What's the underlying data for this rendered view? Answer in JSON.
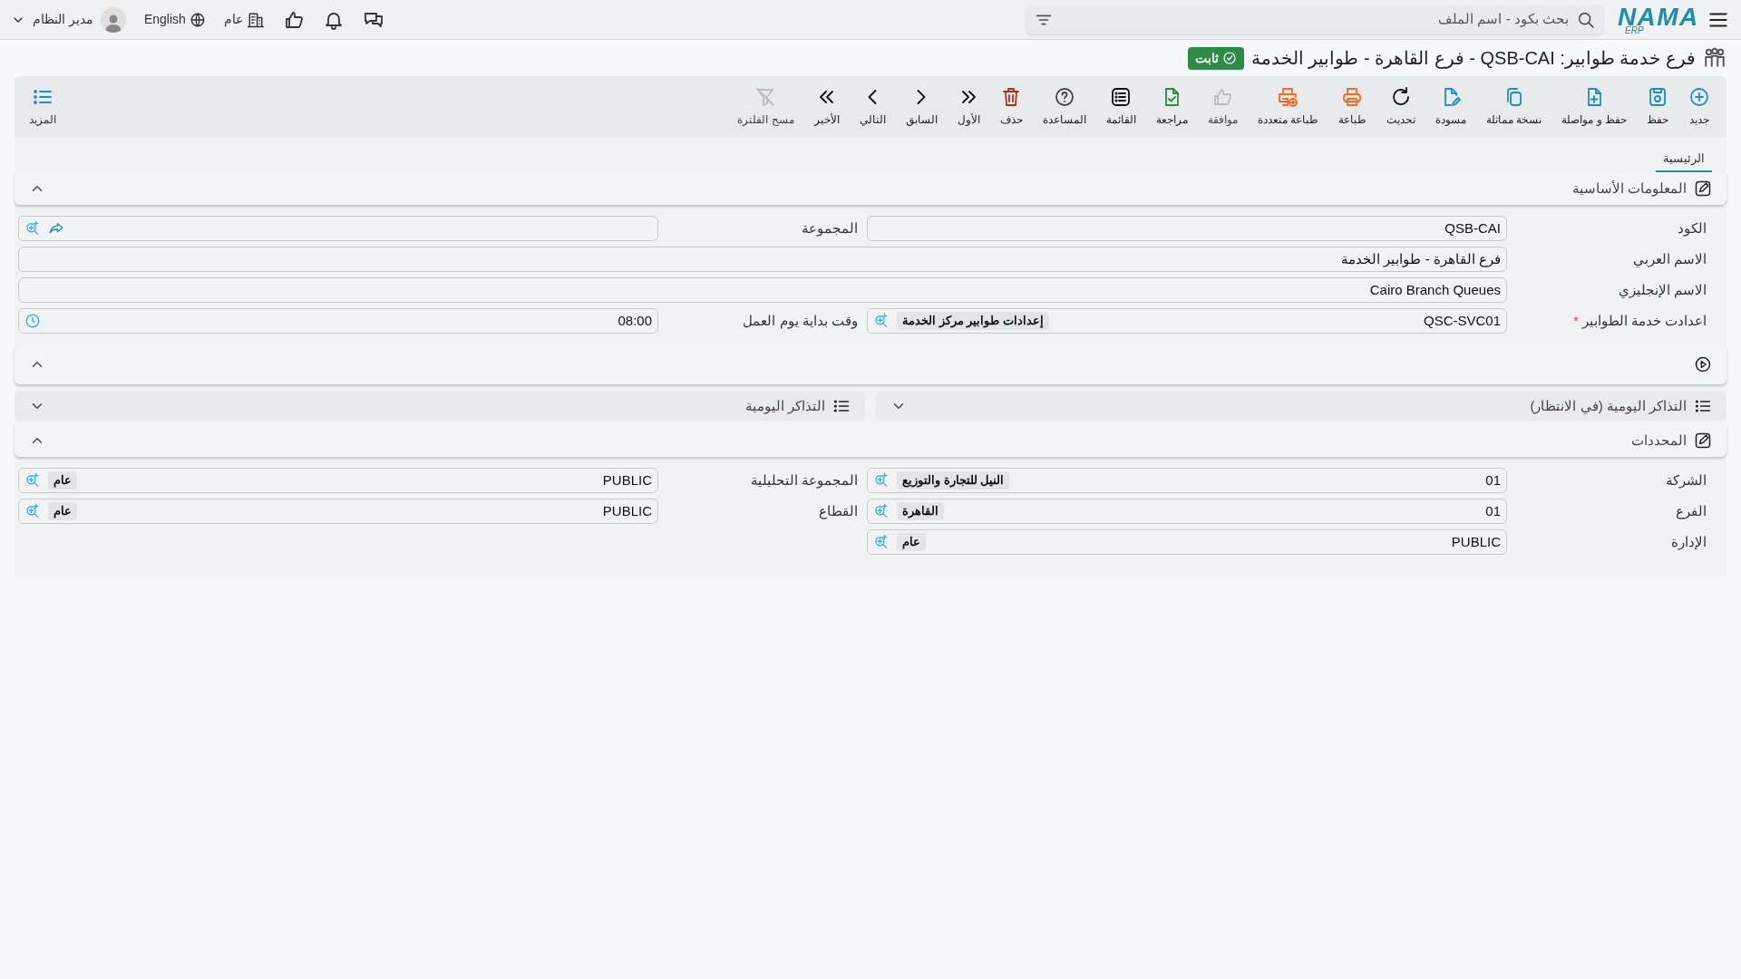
{
  "top_bar": {
    "logo": {
      "main": "NAMA",
      "sub": "ERP"
    },
    "search": {
      "placeholder": "بحث بكود - اسم الملف"
    },
    "scope": "عام",
    "language": "English",
    "user": "مدير النظام"
  },
  "page_title": {
    "text": "فرع خدمة طوابير: QSB-CAI - فرع القاهرة - طوابير الخدمة",
    "status": "ثابت"
  },
  "toolbar": [
    {
      "label": "جديد",
      "disabled": false
    },
    {
      "label": "حفظ",
      "disabled": false
    },
    {
      "label": "حفظ و مواصلة",
      "disabled": false
    },
    {
      "label": "نسخة مماثلة",
      "disabled": false
    },
    {
      "label": "مسودة",
      "disabled": false
    },
    {
      "label": "تحديث",
      "disabled": false
    },
    {
      "label": "طباعة",
      "disabled": false
    },
    {
      "label": "طباعة متعددة",
      "disabled": false
    },
    {
      "label": "موافقة",
      "disabled": true
    },
    {
      "label": "مراجعة",
      "disabled": false
    },
    {
      "label": "القائمة",
      "disabled": false
    },
    {
      "label": "المساعدة",
      "disabled": false
    },
    {
      "label": "حذف",
      "disabled": false
    },
    {
      "label": "الأول",
      "disabled": false
    },
    {
      "label": "السابق",
      "disabled": false
    },
    {
      "label": "التالي",
      "disabled": false
    },
    {
      "label": "الأخير",
      "disabled": false
    },
    {
      "label": "مسح الفلترة",
      "disabled": true
    }
  ],
  "more": {
    "label": "المزيد"
  },
  "tabs": [
    {
      "label": "الرئيسية",
      "selected": true
    }
  ],
  "sections": [
    {
      "kind": "form",
      "title": "المعلومات الأساسية",
      "expanded": true,
      "rows": [
        [
          {
            "label": "الكود",
            "value": "QSB-CAI",
            "kind": "text"
          },
          {
            "label": "المجموعة",
            "kind": "group"
          }
        ],
        [
          {
            "label": "الاسم العربي",
            "value": "فرع القاهرة - طوابير الخدمة",
            "kind": "text"
          }
        ],
        [
          {
            "label": "الاسم الإنجليزي",
            "value": "Cairo Branch Queues",
            "kind": "text"
          }
        ],
        [
          {
            "label": "اعدادت خدمة الطوابير",
            "value": "QSC-SVC01",
            "tag": "إعدادات طوابير مركز الخدمة",
            "kind": "lookup",
            "required_mark": "*"
          },
          {
            "label": "وقت بداية يوم العمل",
            "value": "08:00",
            "kind": "time"
          }
        ]
      ]
    },
    {
      "kind": "bar",
      "expanded": true
    },
    {
      "kind": "split",
      "panels": [
        {
          "title": "التذاكر اليومية (في الانتظار)",
          "expanded": false
        },
        {
          "title": "التذاكر اليومية",
          "expanded": false
        }
      ]
    },
    {
      "kind": "form",
      "title": "المحددات",
      "expanded": true,
      "rows": [
        [
          {
            "label": "الشركة",
            "value": "01",
            "tag": "النيل للتجارة والتوزيع",
            "kind": "lookup"
          },
          {
            "label": "المجموعة التحليلية",
            "value": "PUBLIC",
            "tag": "عام",
            "kind": "lookup"
          }
        ],
        [
          {
            "label": "الفرع",
            "value": "01",
            "tag": "القاهرة",
            "kind": "lookup"
          },
          {
            "label": "القطاع",
            "value": "PUBLIC",
            "tag": "عام",
            "kind": "lookup"
          }
        ],
        [
          {
            "label": "الإدارة",
            "value": "PUBLIC",
            "tag": "عام",
            "kind": "lookup"
          }
        ]
      ]
    }
  ]
}
